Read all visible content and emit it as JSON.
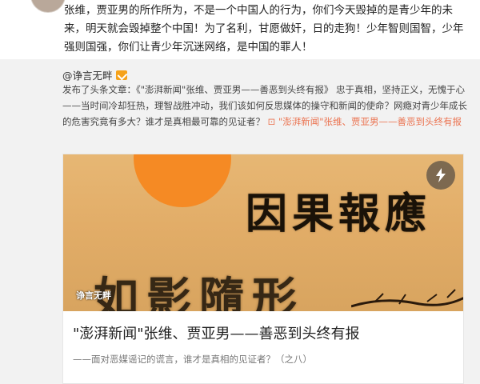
{
  "comment": {
    "text": "张维，贾亚男的所作所为，不是一个中国人的行为，你们今天毁掉的是青少年的未来，明天就会毁掉整个中国！为了名利，甘愿做奸，日的走狗！少年智则国智，少年强则国强，你们让青少年沉迷网络，是中国的罪人！"
  },
  "repost": {
    "author": "@诤言无畔",
    "description_prefix": "发布了头条文章：《\"澎湃新闻\"张维、贾亚男——善恶到头终有报》 忠于真相，坚持正义，无愧于心——当时间冷却狂热，理智战胜冲动，我们该如何反思媒体的操守和新闻的使命？网瘾对青少年成长的危害究竟有多大？谁才是真相最可靠的见证者？",
    "link_icon": "link-icon",
    "link_text": "\"澎湃新闻\"张维、贾亚男——善恶到头终有报"
  },
  "card": {
    "banner_title": "因果報應",
    "banner_subtitle": "如影隨形",
    "watermark": "诤言无畔",
    "title": "\"澎湃新闻\"张维、贾亚男——善恶到头终有报",
    "subtitle": "——面对恶媒谣记的谎言，谁才是真相的见证者？（之八）"
  },
  "colors": {
    "link": "#eb7350",
    "sun": "#f58a24",
    "banner_bg": "#e2ad68"
  }
}
